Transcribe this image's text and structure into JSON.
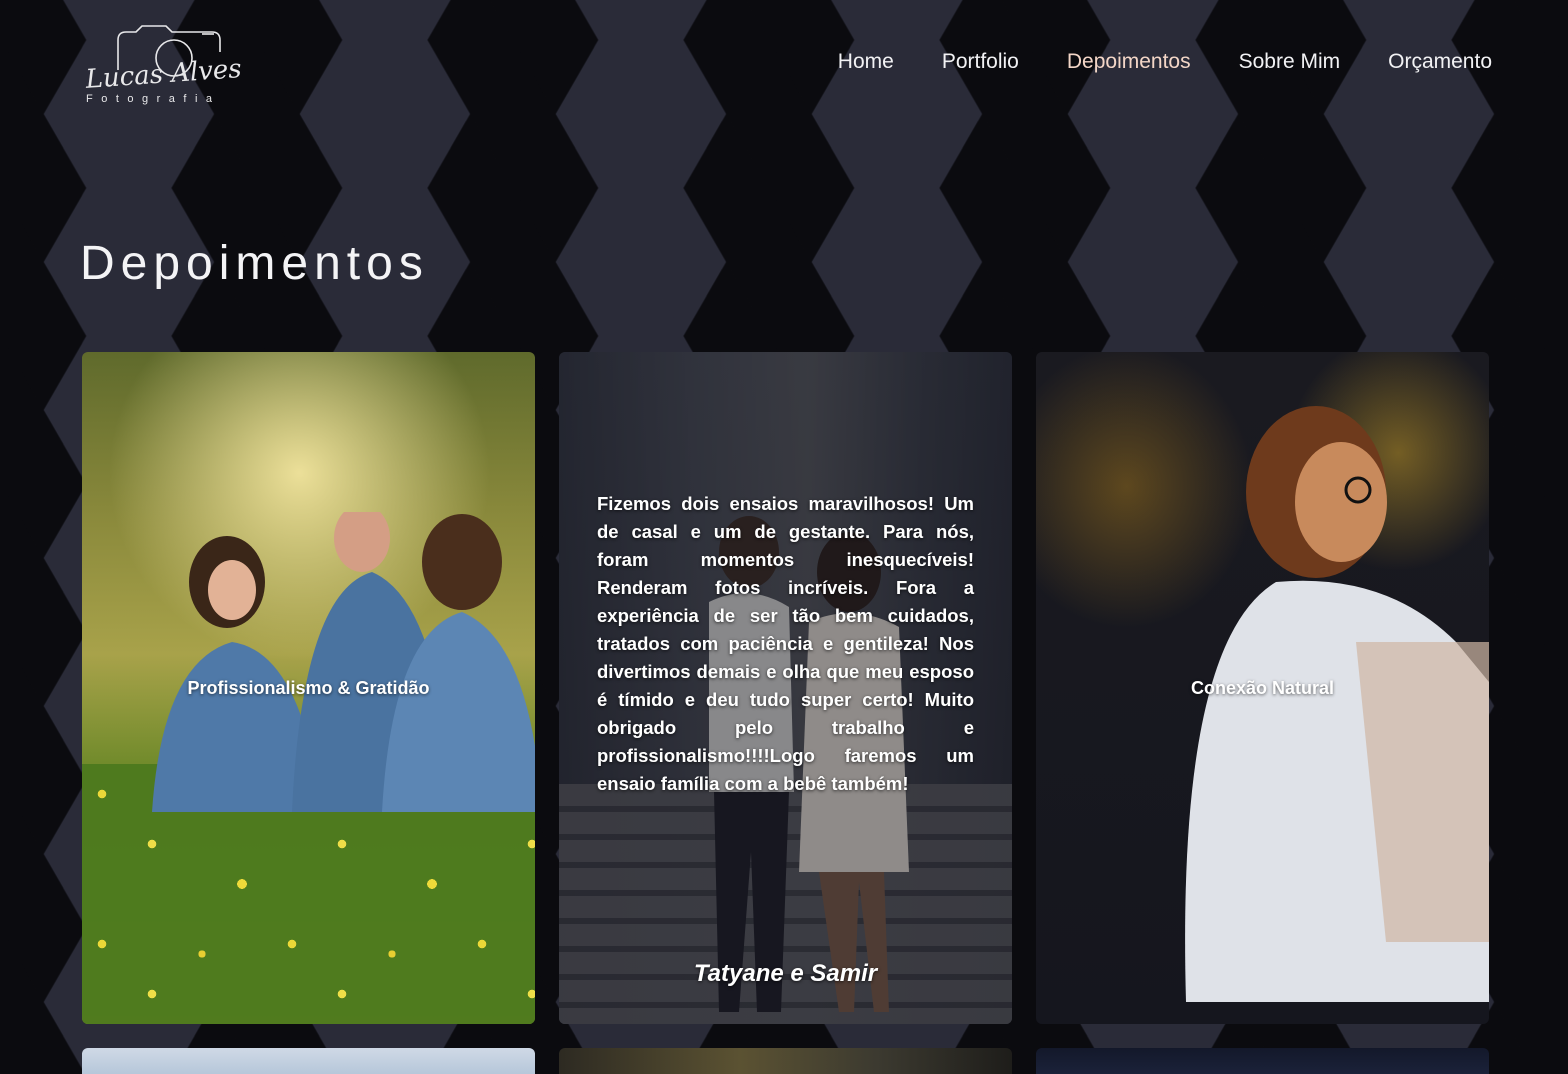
{
  "brand": {
    "logo_script": "Lucas Alves",
    "logo_sub": "Fotografia"
  },
  "nav": {
    "items": [
      {
        "label": "Home"
      },
      {
        "label": "Portfolio"
      },
      {
        "label": "Depoimentos"
      },
      {
        "label": "Sobre Mim"
      },
      {
        "label": "Orçamento"
      }
    ],
    "active_color": "#f3d6c7"
  },
  "page": {
    "title": "Depoimentos"
  },
  "testimonials": [
    {
      "caption": "Profissionalismo & Gratidão",
      "photo": "family-in-meadow"
    },
    {
      "text": "Fizemos dois ensaios maravilhosos! Um de casal e um de gestante. Para nós, foram momentos inesquecíveis! Renderam fotos incríveis. Fora a experiência de ser tão bem cuidados, tratados com paciência e gentileza! Nos divertimos demais e olha que meu esposo é tímido e deu tudo super certo! Muito obrigado pelo trabalho e profissionalismo!!!!Logo faremos um ensaio família com a bebê também!",
      "author": "Tatyane e Samir",
      "photo": "couple-on-stairs"
    },
    {
      "caption": "Conexão Natural",
      "photo": "woman-in-foliage"
    }
  ]
}
